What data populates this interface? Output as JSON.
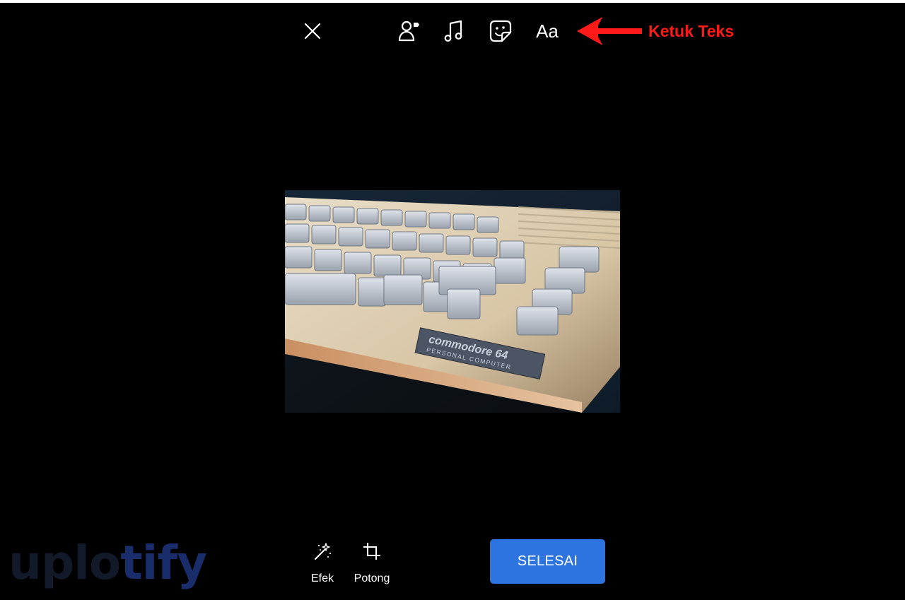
{
  "toolbar": {
    "close_icon": "close-icon",
    "tag_icon": "tag-people-icon",
    "music_icon": "music-note-icon",
    "sticker_icon": "sticker-icon",
    "text_button_label": "Aa"
  },
  "annotation": {
    "text": "Ketuk Teks",
    "color": "#ff1a1a"
  },
  "bottom_tools": {
    "effects_label": "Efek",
    "crop_label": "Potong"
  },
  "done_button": {
    "label": "SELESAI",
    "color": "#2d74e0"
  },
  "photo": {
    "badge_line1": "commodore 64",
    "badge_line2": "PERSONAL COMPUTER"
  },
  "watermark": {
    "part1": "uplo",
    "part2": "tify"
  }
}
